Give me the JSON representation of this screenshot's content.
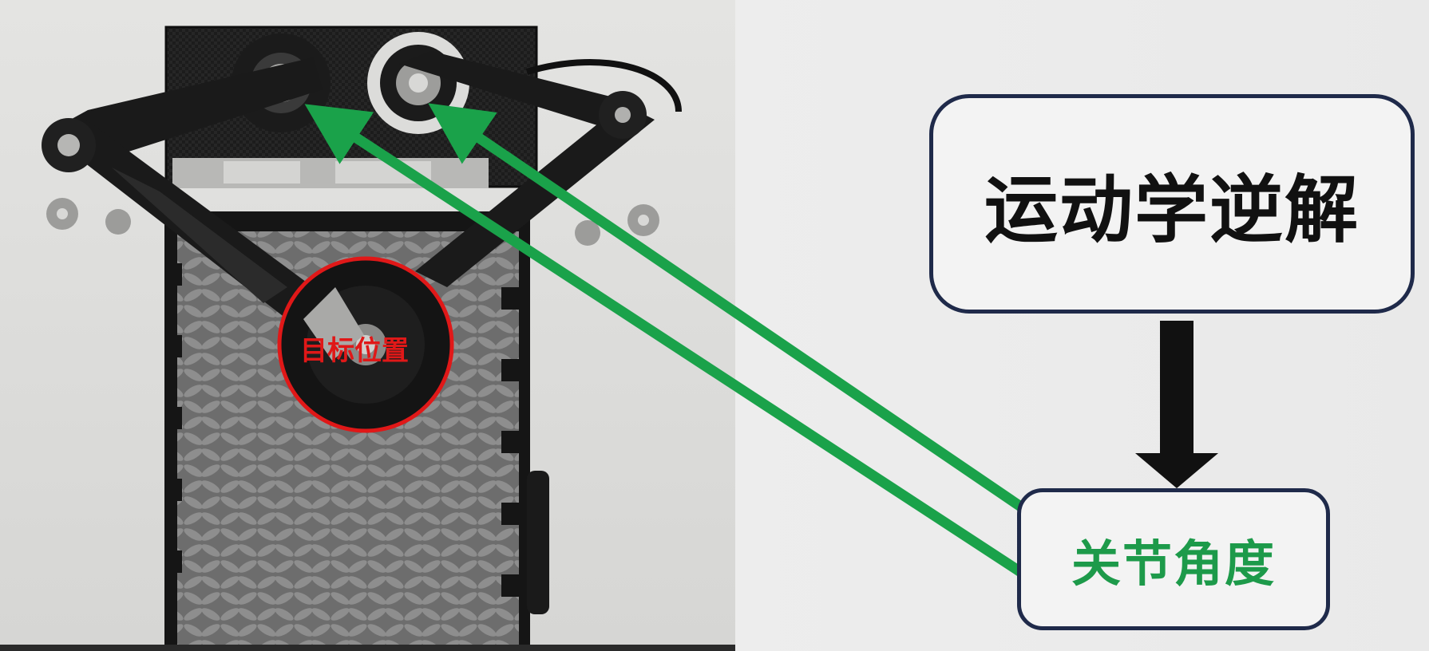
{
  "photo": {
    "target_label": "目标位置"
  },
  "diagram": {
    "ik_box_label": "运动学逆解",
    "joint_box_label": "关节角度"
  },
  "colors": {
    "arrow_green": "#1aa24a",
    "target_circle_red": "#e01818",
    "box_border_navy": "#1f2a4a",
    "flow_arrow_black": "#111111"
  }
}
